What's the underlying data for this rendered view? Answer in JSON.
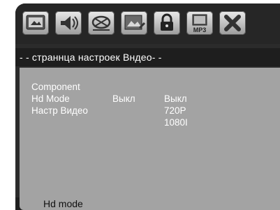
{
  "header": {
    "title": "- - страннца  настроек Вндео- -"
  },
  "tabs": [
    {
      "icon": "system-icon"
    },
    {
      "icon": "audio-icon"
    },
    {
      "icon": "video-icon"
    },
    {
      "icon": "preference-icon"
    },
    {
      "icon": "lock-icon"
    },
    {
      "icon": "mp3-icon",
      "label": "MP3"
    },
    {
      "icon": "exit-icon"
    }
  ],
  "menu": {
    "items": [
      {
        "label": "Component",
        "value": ""
      },
      {
        "label": "Hd Mode",
        "value": "Выкл"
      },
      {
        "label": "Настр Видео",
        "value": ""
      }
    ],
    "options": [
      "Выкл",
      "720P",
      "1080I"
    ]
  },
  "status_bar": {
    "text": "Hd mode"
  },
  "colors": {
    "panel": "#a3a3a3",
    "background": "#2b2b2b",
    "text": "#ffffff"
  }
}
